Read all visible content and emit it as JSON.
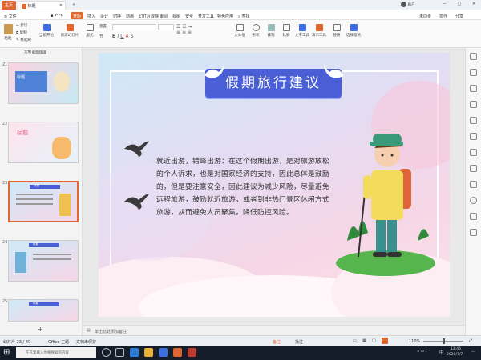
{
  "titlebar": {
    "home_tab": "主页",
    "doc_tab": "标题",
    "plus": "+",
    "right_label": "账户",
    "win_controls": [
      "—",
      "□",
      "✕"
    ]
  },
  "menu": {
    "file": "文件",
    "tabs": [
      "开始",
      "插入",
      "设计",
      "切换",
      "动画",
      "幻灯片放映",
      "审阅",
      "视图",
      "安全",
      "开发工具",
      "特色应用"
    ],
    "active_index": 0,
    "search": "查找",
    "right": [
      "未同步",
      "协作",
      "分享"
    ]
  },
  "toolbar": {
    "paste": "粘贴",
    "cut": "剪切",
    "copy": "复制",
    "format": "格式刷",
    "from_current": "当前开始",
    "new_slide": "新建幻灯片",
    "layout": "版式",
    "section": "节",
    "reset": "重置",
    "textbox": "文本框",
    "shapes": "形状",
    "arrange": "排列",
    "outline": "轮廓",
    "text_tool": "文字工具",
    "slide_show": "演示工具",
    "replace": "替换",
    "select_pane": "选择窗格",
    "picture_ribbon": "图片"
  },
  "leftpane": {
    "tab_outline": "大纲",
    "tab_slides": "幻灯片",
    "thumbs": [
      {
        "num": "21",
        "caption": "标题"
      },
      {
        "num": "22",
        "caption": "标题"
      },
      {
        "num": "23",
        "caption": "标题"
      },
      {
        "num": "24",
        "caption": "标题"
      },
      {
        "num": "25",
        "caption": "标题"
      }
    ],
    "add": "+"
  },
  "slide": {
    "title": "假期旅行建议",
    "body": "就近出游，错峰出游：在这个假期出游，是对旅游放松的个人诉求，也是对国家经济的支持，因此总体是鼓励的，但是要注意安全，因此建议为减少风险，尽量避免远程旅游，鼓励就近旅游，或者到非热门景区休闲方式旅游，从而避免人员聚集，降低防控风险。"
  },
  "notes": {
    "placeholder": "单击此处添加备注"
  },
  "status": {
    "slide_info": "幻灯片 23 / 40",
    "theme": "Office 主题",
    "protect": "文档未保护",
    "notes_btn": "备注",
    "comments_btn": "批注",
    "zoom": "110%"
  },
  "taskbar": {
    "search_placeholder": "在这里输入你要搜索的内容",
    "time": "12:46",
    "date": "2020/7/7",
    "lang": "中"
  },
  "colors": {
    "accent": "#d9534f",
    "ribbon_blue": "#3d6ee0",
    "title_banner": "#4a5fd6"
  }
}
